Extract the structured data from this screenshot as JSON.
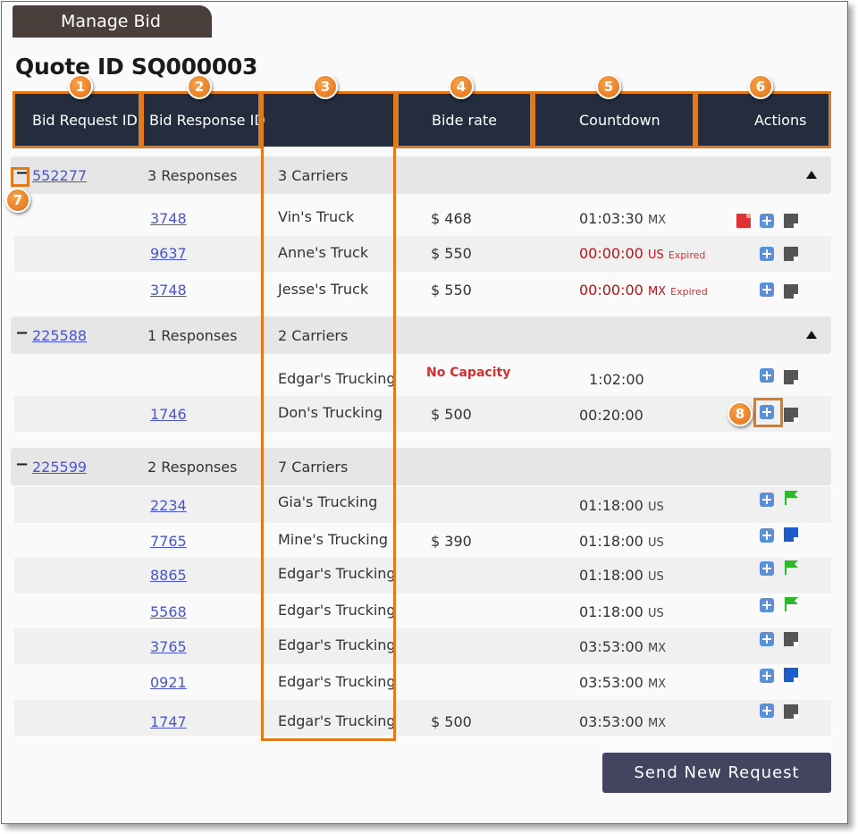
{
  "tab": {
    "label": "Manage Bid"
  },
  "title": "Quote ID SQ000003",
  "columns": {
    "bid_request_id": "Bid Request ID",
    "bid_response_id": "Bid Response ID",
    "carrier": "",
    "bide_rate": "Bide rate",
    "countdown": "Countdown",
    "actions": "Actions"
  },
  "callouts": [
    "1",
    "2",
    "3",
    "4",
    "5",
    "6",
    "7",
    "8"
  ],
  "groups": [
    {
      "toggle": "−",
      "request_id": "552277",
      "responses": "3 Responses",
      "carriers": "3 Carriers",
      "collapse_icon": "triangle-up-icon"
    },
    {
      "toggle": "−",
      "request_id": "225588",
      "responses": "1 Responses",
      "carriers": "2 Carriers",
      "collapse_icon": "triangle-up-icon"
    },
    {
      "toggle": "−",
      "request_id": "225599",
      "responses": "2 Responses",
      "carriers": "7 Carriers"
    }
  ],
  "rows": [
    {
      "response_id": "3748",
      "carrier": "Vin's Truck",
      "rate": "$ 468",
      "countdown": "01:03:30",
      "tz": "MX",
      "expired": "",
      "icons": [
        "pdf-icon",
        "add-icon",
        "note-icon"
      ]
    },
    {
      "response_id": "9637",
      "carrier": "Anne's Truck",
      "rate": "$ 550",
      "countdown": "00:00:00",
      "tz": "US",
      "expired": "Expired",
      "icons": [
        "add-icon",
        "note-icon"
      ]
    },
    {
      "response_id": "3748",
      "carrier": "Jesse's Truck",
      "rate": "$ 550",
      "countdown": "00:00:00",
      "tz": "MX",
      "expired": "Expired",
      "icons": [
        "add-icon",
        "note-icon"
      ]
    },
    {
      "response_id": "",
      "carrier": "Edgar's Trucking",
      "rate": "No Capacity",
      "countdown": "1:02:00",
      "tz": "",
      "expired": "",
      "icons": [
        "add-icon",
        "note-icon"
      ]
    },
    {
      "response_id": "1746",
      "carrier": "Don's Trucking",
      "rate": "$ 500",
      "countdown": "00:20:00",
      "tz": "",
      "expired": "",
      "icons": [
        "add-icon",
        "note-icon"
      ]
    },
    {
      "response_id": "2234",
      "carrier": "Gia's Trucking",
      "rate": "",
      "countdown": "01:18:00",
      "tz": "US",
      "expired": "",
      "icons": [
        "add-icon",
        "flag-icon"
      ]
    },
    {
      "response_id": "7765",
      "carrier": "Mine's Trucking",
      "rate": "$ 390",
      "countdown": "01:18:00",
      "tz": "US",
      "expired": "",
      "icons": [
        "add-icon",
        "note-icon"
      ]
    },
    {
      "response_id": "8865",
      "carrier": "Edgar's Trucking",
      "rate": "",
      "countdown": "01:18:00",
      "tz": "US",
      "expired": "",
      "icons": [
        "add-icon",
        "flag-icon"
      ]
    },
    {
      "response_id": "5568",
      "carrier": "Edgar's Trucking",
      "rate": "",
      "countdown": "01:18:00",
      "tz": "US",
      "expired": "",
      "icons": [
        "add-icon",
        "flag-icon"
      ]
    },
    {
      "response_id": "3765",
      "carrier": "Edgar's Trucking",
      "rate": "",
      "countdown": "03:53:00",
      "tz": "MX",
      "expired": "",
      "icons": [
        "add-icon",
        "note-icon"
      ]
    },
    {
      "response_id": "0921",
      "carrier": "Edgar's Trucking",
      "rate": "",
      "countdown": "03:53:00",
      "tz": "MX",
      "expired": "",
      "icons": [
        "add-icon",
        "note-icon"
      ]
    },
    {
      "response_id": "1747",
      "carrier": "Edgar's Trucking",
      "rate": "$ 500",
      "countdown": "03:53:00",
      "tz": "MX",
      "expired": "",
      "icons": [
        "add-icon",
        "note-icon"
      ]
    }
  ],
  "colors": {
    "header_bg": "#232d3d",
    "callout": "#e07b1d",
    "expired_red": "#b3141a",
    "link_blue": "#4a55c9",
    "flag_green": "#2db82d",
    "note_blue": "#1e5cc9",
    "button_bg": "#434560"
  },
  "send_button": "Send New Request"
}
